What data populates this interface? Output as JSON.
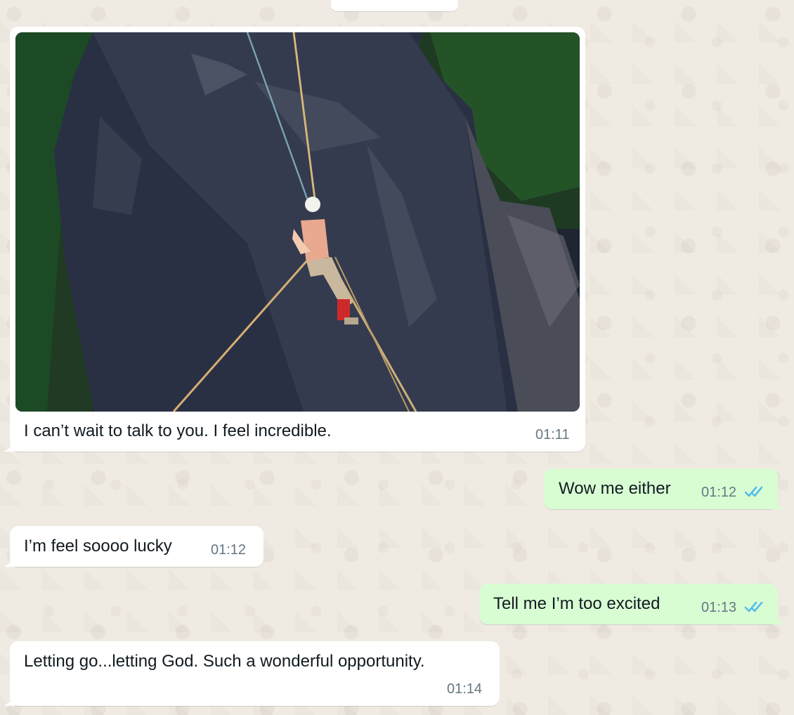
{
  "messages": [
    {
      "direction": "incoming",
      "has_image": true,
      "image_icon": "photo",
      "text": "I can’t wait to talk to you. I feel incredible.",
      "time": "01:11"
    },
    {
      "direction": "outgoing",
      "text": "Wow me either",
      "time": "01:12",
      "status_icon": "double-check-read"
    },
    {
      "direction": "incoming",
      "text": "I’m feel soooo lucky",
      "time": "01:12"
    },
    {
      "direction": "outgoing",
      "text": "Tell me I’m too excited",
      "time": "01:13",
      "status_icon": "double-check-read"
    },
    {
      "direction": "incoming",
      "text": "Letting go...letting God. Such a wonderful opportunity.",
      "time": "01:14"
    }
  ],
  "colors": {
    "background": "#efeae2",
    "incoming_bubble": "#ffffff",
    "outgoing_bubble": "#d9fdd3",
    "time_text": "#667781",
    "read_ticks": "#53bdeb"
  }
}
